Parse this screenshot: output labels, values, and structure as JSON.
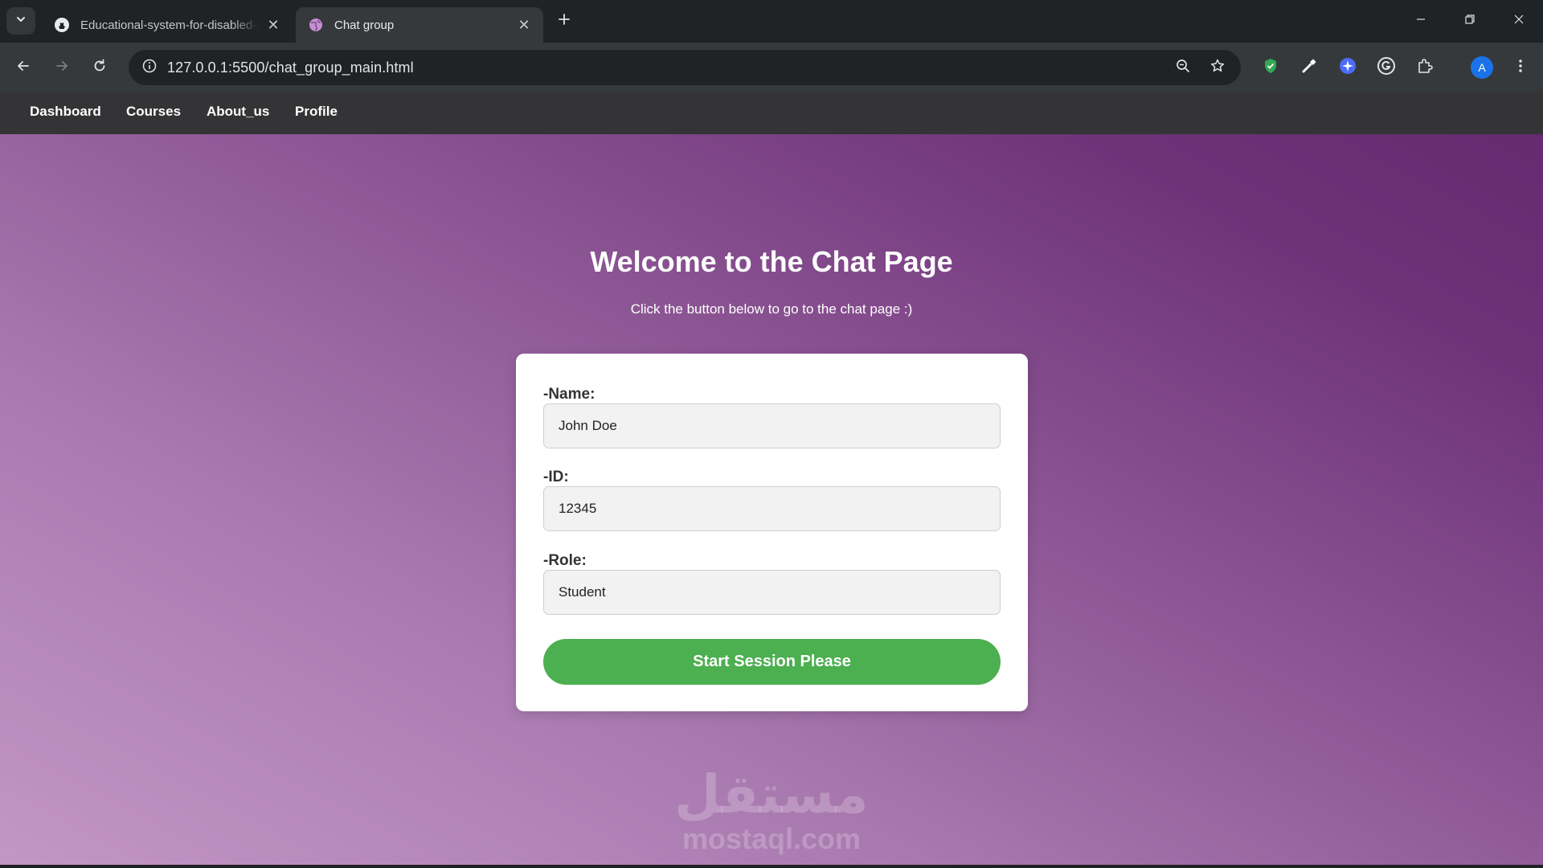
{
  "browser": {
    "tabs": [
      {
        "title": "Educational-system-for-disabled-/",
        "favicon": "github-icon"
      },
      {
        "title": "Chat group",
        "favicon": "globe-icon",
        "active": true
      }
    ],
    "address": "127.0.0.1:5500/chat_group_main.html",
    "profile_initial": "A"
  },
  "site_nav": {
    "items": [
      {
        "label": "Dashboard"
      },
      {
        "label": "Courses"
      },
      {
        "label": "About_us"
      },
      {
        "label": "Profile"
      }
    ]
  },
  "main": {
    "heading": "Welcome to the Chat Page",
    "subtitle": "Click the button below to go to the chat page :)"
  },
  "form": {
    "name_label": "-Name:",
    "name_value": "John Doe",
    "id_label": "-ID:",
    "id_value": "12345",
    "role_label": "-Role:",
    "role_value": "Student",
    "submit_label": "Start Session Please"
  },
  "watermark": {
    "arabic": "مستقل",
    "latin": "mostaql.com"
  },
  "colors": {
    "button_green": "#4caf50",
    "nav_bar": "#343335",
    "gradient_light": "#c296c6",
    "gradient_dark": "#63286e"
  }
}
